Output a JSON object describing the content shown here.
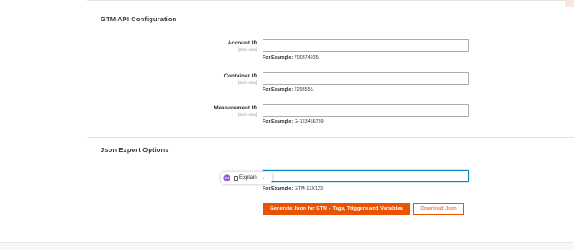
{
  "gtm_section": {
    "title": "GTM API Configuration",
    "fields": [
      {
        "label": "Account ID",
        "scope": "[store view]",
        "value": "",
        "note_label": "For Example:",
        "note_value": "700374935."
      },
      {
        "label": "Container ID",
        "scope": "[store view]",
        "value": "",
        "note_label": "For Example:",
        "note_value": "2293555."
      },
      {
        "label": "Measurement ID",
        "scope": "[store view]",
        "value": "",
        "note_label": "For Example:",
        "note_value": "G-123456789"
      }
    ]
  },
  "json_section": {
    "title": "Json Export Options",
    "field": {
      "value": "",
      "note_label": "For Example:",
      "note_value": "GTM-12X123"
    },
    "generate_button": "Generate Json for GTM - Tags, Triggers and Variables",
    "download_button": "Download Json"
  },
  "explain_popup": {
    "label": "Explain",
    "chevron": "⌄"
  },
  "colors": {
    "accent": "#eb5202",
    "focus_border": "#0a82c4"
  }
}
